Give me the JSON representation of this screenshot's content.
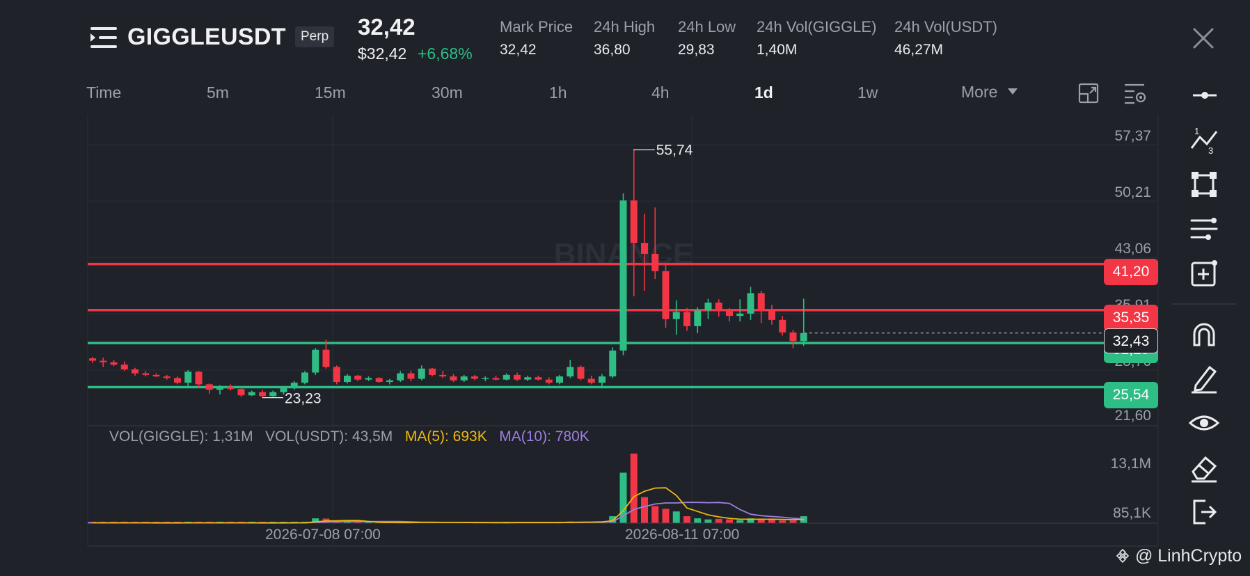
{
  "header": {
    "symbol": "GIGGLEUSDT",
    "contract_type": "Perp",
    "last_price": "32,42",
    "usd_price": "$32,42",
    "change_pct": "+6,68%",
    "stats": [
      {
        "label": "Mark Price",
        "value": "32,42"
      },
      {
        "label": "24h High",
        "value": "36,80"
      },
      {
        "label": "24h Low",
        "value": "29,83"
      },
      {
        "label": "24h Vol(GIGGLE)",
        "value": "1,40M"
      },
      {
        "label": "24h Vol(USDT)",
        "value": "46,27M"
      }
    ]
  },
  "timeframes": {
    "time_label": "Time",
    "items": [
      "5m",
      "15m",
      "30m",
      "1h",
      "4h",
      "1d",
      "1w"
    ],
    "active": "1d",
    "more_label": "More"
  },
  "chart": {
    "y_axis_labels": [
      "57,37",
      "50,21",
      "43,06",
      "35,91",
      "28,76",
      "21,60"
    ],
    "high_marker": "55,74",
    "low_marker": "23,23",
    "price_lines": [
      {
        "value": "41,20",
        "color": "#f23645"
      },
      {
        "value": "35,35",
        "color": "#f23645"
      },
      {
        "value": "31,15",
        "color": "#2ebd85"
      },
      {
        "value": "25,54",
        "color": "#2ebd85"
      }
    ],
    "current_price_tag": "32,43",
    "watermark_text": "BINANCE",
    "x_labels": [
      "2026-07-08 07:00",
      "2026-08-11 07:00"
    ]
  },
  "volume": {
    "legend_vol_giggle": "VOL(GIGGLE): 1,31M",
    "legend_vol_usdt": "VOL(USDT): 43,5M",
    "legend_ma5": "MA(5): 693K",
    "legend_ma10": "MA(10): 780K",
    "y_labels": [
      "13,1M",
      "85,1K"
    ],
    "ma5_color": "#f0b90b",
    "ma10_color": "#9d7fe0"
  },
  "colors": {
    "up": "#2ebd85",
    "down": "#f23645",
    "bg": "#1f2229"
  },
  "sidebar_tools": [
    "horizontal-line-icon",
    "fibonacci-icon",
    "shapes-icon",
    "indicator-settings-icon",
    "measure-icon",
    "magnet-icon",
    "pencil-icon",
    "eye-icon",
    "eraser-icon",
    "exit-icon"
  ],
  "credit": "@ LinhCrypto",
  "chart_data": {
    "type": "candlestick",
    "title": "",
    "ylim": [
      21.6,
      57.37
    ],
    "candles_ohlc": [
      [
        29.2,
        29.4,
        28.6,
        28.9
      ],
      [
        28.9,
        29.3,
        28.1,
        28.7
      ],
      [
        28.7,
        29.0,
        28.2,
        28.4
      ],
      [
        28.4,
        28.8,
        27.6,
        27.8
      ],
      [
        27.8,
        28.0,
        27.0,
        27.3
      ],
      [
        27.3,
        27.6,
        26.9,
        27.1
      ],
      [
        27.1,
        27.3,
        26.8,
        26.9
      ],
      [
        26.9,
        27.1,
        26.5,
        26.7
      ],
      [
        26.7,
        26.9,
        25.9,
        26.1
      ],
      [
        26.1,
        27.7,
        25.7,
        27.5
      ],
      [
        27.5,
        27.6,
        25.4,
        25.9
      ],
      [
        25.9,
        26.0,
        24.7,
        25.2
      ],
      [
        25.2,
        25.8,
        24.6,
        25.6
      ],
      [
        25.6,
        25.9,
        25.1,
        25.3
      ],
      [
        25.3,
        25.5,
        24.3,
        24.5
      ],
      [
        24.5,
        25.1,
        24.4,
        24.9
      ],
      [
        24.9,
        25.2,
        24.2,
        24.4
      ],
      [
        24.4,
        25.1,
        24.3,
        24.9
      ],
      [
        24.9,
        25.5,
        24.6,
        25.4
      ],
      [
        25.4,
        26.3,
        25.2,
        26.1
      ],
      [
        26.1,
        27.6,
        25.9,
        27.4
      ],
      [
        27.4,
        30.5,
        27.1,
        30.3
      ],
      [
        30.3,
        31.6,
        27.9,
        28.1
      ],
      [
        28.1,
        28.3,
        25.9,
        26.2
      ],
      [
        26.2,
        27.2,
        26.0,
        27.0
      ],
      [
        27.0,
        27.1,
        26.3,
        26.5
      ],
      [
        26.5,
        26.9,
        26.3,
        26.7
      ],
      [
        26.7,
        26.8,
        26.1,
        26.2
      ],
      [
        26.2,
        26.6,
        25.9,
        26.4
      ],
      [
        26.4,
        27.6,
        26.2,
        27.3
      ],
      [
        27.3,
        27.6,
        26.3,
        26.6
      ],
      [
        26.6,
        28.3,
        26.4,
        27.9
      ],
      [
        27.9,
        28.0,
        26.9,
        27.1
      ],
      [
        27.1,
        27.6,
        26.7,
        26.9
      ],
      [
        26.9,
        27.2,
        26.2,
        26.4
      ],
      [
        26.4,
        27.1,
        26.2,
        26.9
      ],
      [
        26.9,
        27.1,
        26.4,
        26.6
      ],
      [
        26.6,
        26.9,
        26.3,
        26.7
      ],
      [
        26.7,
        27.0,
        26.4,
        26.5
      ],
      [
        26.5,
        27.3,
        26.4,
        27.1
      ],
      [
        27.1,
        27.4,
        26.3,
        26.5
      ],
      [
        26.5,
        27.0,
        26.3,
        26.8
      ],
      [
        26.8,
        27.0,
        26.4,
        26.5
      ],
      [
        26.5,
        26.8,
        25.9,
        26.1
      ],
      [
        26.1,
        27.1,
        25.9,
        26.9
      ],
      [
        26.9,
        29.0,
        26.7,
        28.1
      ],
      [
        28.1,
        28.3,
        26.4,
        26.6
      ],
      [
        26.6,
        27.0,
        25.9,
        26.1
      ],
      [
        26.1,
        27.2,
        25.4,
        26.9
      ],
      [
        26.9,
        30.6,
        26.7,
        30.2
      ],
      [
        30.2,
        50.2,
        29.6,
        49.3
      ],
      [
        49.3,
        55.74,
        37.1,
        43.9
      ],
      [
        43.9,
        47.6,
        37.8,
        42.5
      ],
      [
        42.5,
        48.4,
        39.3,
        40.3
      ],
      [
        40.3,
        41.1,
        33.1,
        34.2
      ],
      [
        34.2,
        36.6,
        32.2,
        35.1
      ],
      [
        35.1,
        35.6,
        32.7,
        33.3
      ],
      [
        33.3,
        35.7,
        32.4,
        35.3
      ],
      [
        35.3,
        36.8,
        34.2,
        36.3
      ],
      [
        36.3,
        36.7,
        34.5,
        35.4
      ],
      [
        35.4,
        35.6,
        33.9,
        34.6
      ],
      [
        34.6,
        36.7,
        33.9,
        34.9
      ],
      [
        34.9,
        38.3,
        34.1,
        37.5
      ],
      [
        37.5,
        37.8,
        33.7,
        35.5
      ],
      [
        35.5,
        36.0,
        33.5,
        34.1
      ],
      [
        34.1,
        34.6,
        32.1,
        32.5
      ],
      [
        32.5,
        32.8,
        30.5,
        31.4
      ],
      [
        31.4,
        36.8,
        30.8,
        32.42
      ]
    ],
    "price_levels": [
      41.2,
      35.35,
      31.15,
      25.54
    ],
    "volume_ylim": [
      0,
      13100000
    ],
    "volumes": [
      60000,
      50000,
      50000,
      50000,
      40000,
      40000,
      40000,
      40000,
      40000,
      70000,
      60000,
      50000,
      50000,
      40000,
      40000,
      40000,
      40000,
      40000,
      50000,
      80000,
      120000,
      900000,
      850000,
      300000,
      200000,
      120000,
      100000,
      90000,
      90000,
      150000,
      120000,
      250000,
      150000,
      100000,
      100000,
      100000,
      90000,
      90000,
      90000,
      120000,
      100000,
      100000,
      90000,
      90000,
      150000,
      300000,
      200000,
      150000,
      250000,
      1300000,
      9500000,
      13100000,
      4900000,
      3200000,
      2700000,
      2200000,
      1300000,
      900000,
      700000,
      800000,
      700000,
      550000,
      900000,
      800000,
      700000,
      500000,
      500000,
      1300000
    ],
    "ma5": [
      60000,
      58000,
      55000,
      53000,
      50000,
      46000,
      43000,
      42000,
      41000,
      46000,
      50000,
      52000,
      55000,
      54000,
      51000,
      46000,
      43000,
      41000,
      43000,
      49000,
      65000,
      240000,
      400000,
      450000,
      480000,
      480000,
      330000,
      160000,
      120000,
      110000,
      110000,
      140000,
      150000,
      150000,
      150000,
      140000,
      110000,
      100000,
      95000,
      98000,
      104000,
      104000,
      102000,
      100000,
      110000,
      145000,
      180000,
      200000,
      230000,
      440000,
      2340000,
      5000000,
      6000000,
      6600000,
      6660000,
      5220000,
      2860000,
      2200000,
      1560000,
      1180000,
      900000,
      730000,
      730000,
      730000,
      730000,
      690000,
      660000,
      693000
    ],
    "ma10": [
      60000,
      59000,
      57000,
      56000,
      54000,
      52000,
      50000,
      48000,
      47000,
      47000,
      48000,
      49000,
      50000,
      50000,
      50000,
      50000,
      50000,
      49000,
      49000,
      51000,
      58000,
      140000,
      220000,
      250000,
      270000,
      280000,
      290000,
      300000,
      305000,
      300000,
      240000,
      170000,
      170000,
      150000,
      140000,
      130000,
      120000,
      115000,
      112000,
      110000,
      115000,
      120000,
      122000,
      120000,
      120000,
      125000,
      135000,
      140000,
      150000,
      290000,
      1350000,
      2600000,
      3100000,
      3600000,
      3800000,
      3800000,
      3900000,
      3900000,
      3850000,
      3890000,
      3720000,
      2560000,
      1680000,
      1400000,
      1250000,
      1120000,
      920000,
      780000
    ]
  }
}
